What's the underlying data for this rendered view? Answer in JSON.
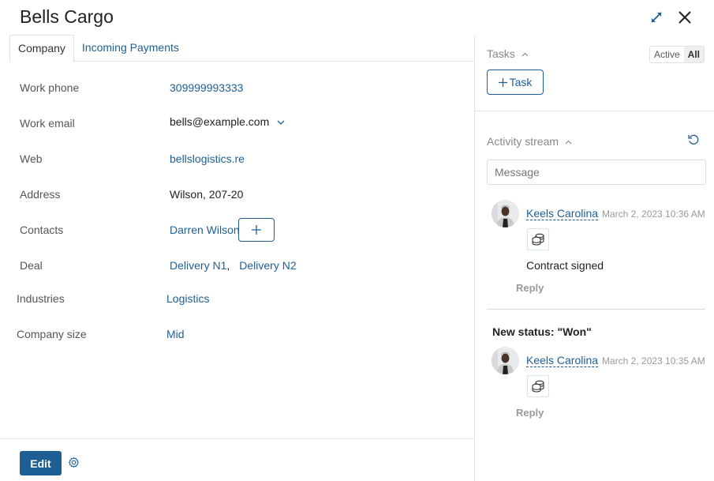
{
  "header": {
    "title": "Bells Cargo",
    "expand_icon": "expand-arrows-icon",
    "close_icon": "close-icon"
  },
  "tabs": [
    {
      "label": "Company",
      "active": true
    },
    {
      "label": "Incoming Payments",
      "active": false
    }
  ],
  "fields": {
    "work_phone": {
      "label": "Work phone",
      "value": "309999993333"
    },
    "work_email": {
      "label": "Work email",
      "value": "bells@example.com"
    },
    "web": {
      "label": "Web",
      "value": "bellslogistics.re"
    },
    "address": {
      "label": "Address",
      "value": "Wilson, 207-20"
    },
    "contacts": {
      "label": "Contacts",
      "value": "Darren Wilson",
      "add_label": "+"
    },
    "deal": {
      "label": "Deal",
      "values": [
        "Delivery N1",
        "Delivery N2"
      ],
      "separator": ","
    },
    "industries": {
      "label": "Industries",
      "value": "Logistics"
    },
    "company_size": {
      "label": "Company size",
      "value": "Mid"
    }
  },
  "footer": {
    "edit_label": "Edit",
    "settings_icon": "gear-icon"
  },
  "tasks": {
    "title": "Tasks",
    "filters": [
      "Active",
      "All"
    ],
    "selected_filter": "All",
    "add_label": "Task"
  },
  "activity": {
    "title": "Activity stream",
    "message_placeholder": "Message",
    "entries": [
      {
        "author": "Keels Carolina",
        "timestamp": "March 2, 2023 10:36 AM",
        "attachment_icon": "coins-icon",
        "text": "Contract signed",
        "reply_label": "Reply"
      },
      {
        "heading": "New status: \"Won\"",
        "author": "Keels Carolina",
        "timestamp": "March 2, 2023 10:35 AM",
        "attachment_icon": "coins-icon",
        "reply_label": "Reply"
      }
    ]
  },
  "colors": {
    "accent": "#1d5f94",
    "border": "#e4e4e4",
    "muted_text": "#888888"
  }
}
